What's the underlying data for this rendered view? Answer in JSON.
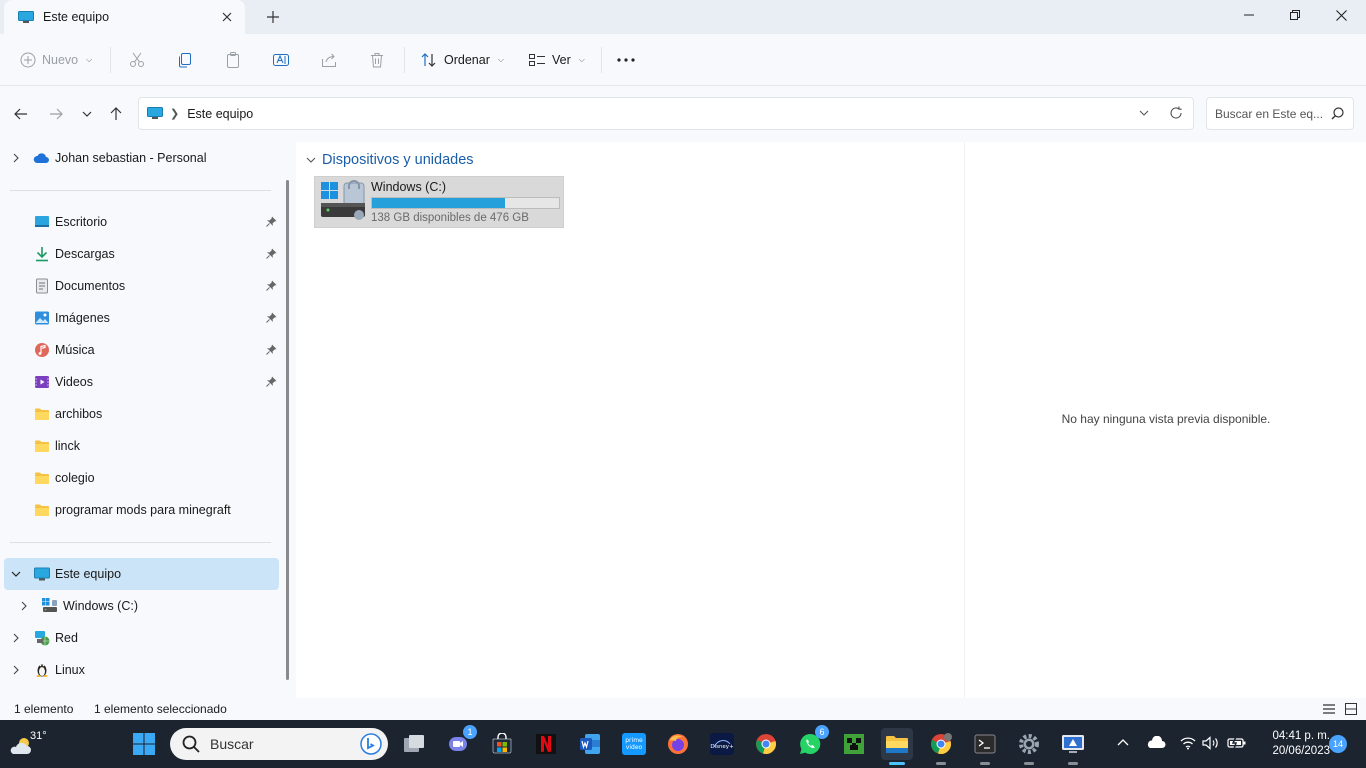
{
  "window": {
    "tab_title": "Este equipo"
  },
  "toolbar": {
    "new_label": "Nuevo",
    "sort_label": "Ordenar",
    "view_label": "Ver"
  },
  "address": {
    "path_label": "Este equipo",
    "search_placeholder": "Buscar en Este eq..."
  },
  "sidebar": {
    "account": "Johan sebastian - Personal",
    "quick_access": [
      {
        "label": "Escritorio",
        "icon": "desktop-icon",
        "pinned": true
      },
      {
        "label": "Descargas",
        "icon": "download-icon",
        "pinned": true
      },
      {
        "label": "Documentos",
        "icon": "document-icon",
        "pinned": true
      },
      {
        "label": "Imágenes",
        "icon": "image-icon",
        "pinned": true
      },
      {
        "label": "Música",
        "icon": "music-icon",
        "pinned": true
      },
      {
        "label": "Videos",
        "icon": "video-icon",
        "pinned": true
      },
      {
        "label": "archibos",
        "icon": "folder-icon",
        "pinned": false
      },
      {
        "label": "linck",
        "icon": "folder-icon",
        "pinned": false
      },
      {
        "label": "colegio",
        "icon": "folder-icon",
        "pinned": false
      },
      {
        "label": "programar mods para minegraft",
        "icon": "folder-icon",
        "pinned": false
      }
    ],
    "this_pc": "Este equipo",
    "drive": "Windows (C:)",
    "network": "Red",
    "linux": "Linux"
  },
  "main": {
    "group_title": "Dispositivos y unidades",
    "drive": {
      "name": "Windows (C:)",
      "free_text": "138 GB disponibles de 476 GB",
      "used_fraction": 0.71
    }
  },
  "preview": {
    "empty_text": "No hay ninguna vista previa disponible."
  },
  "status": {
    "count": "1 elemento",
    "selected": "1 elemento seleccionado"
  },
  "taskbar": {
    "temperature": "31°",
    "search_placeholder": "Buscar",
    "teams_badge": "1",
    "whatsapp_badge": "6",
    "time": "04:41 p. m.",
    "date": "20/06/2023",
    "notifications": "14"
  },
  "colors": {
    "accent": "#26a0da",
    "selection": "#cce4f7",
    "group_header": "#1a5ea8",
    "taskbar": "#1c2430"
  }
}
